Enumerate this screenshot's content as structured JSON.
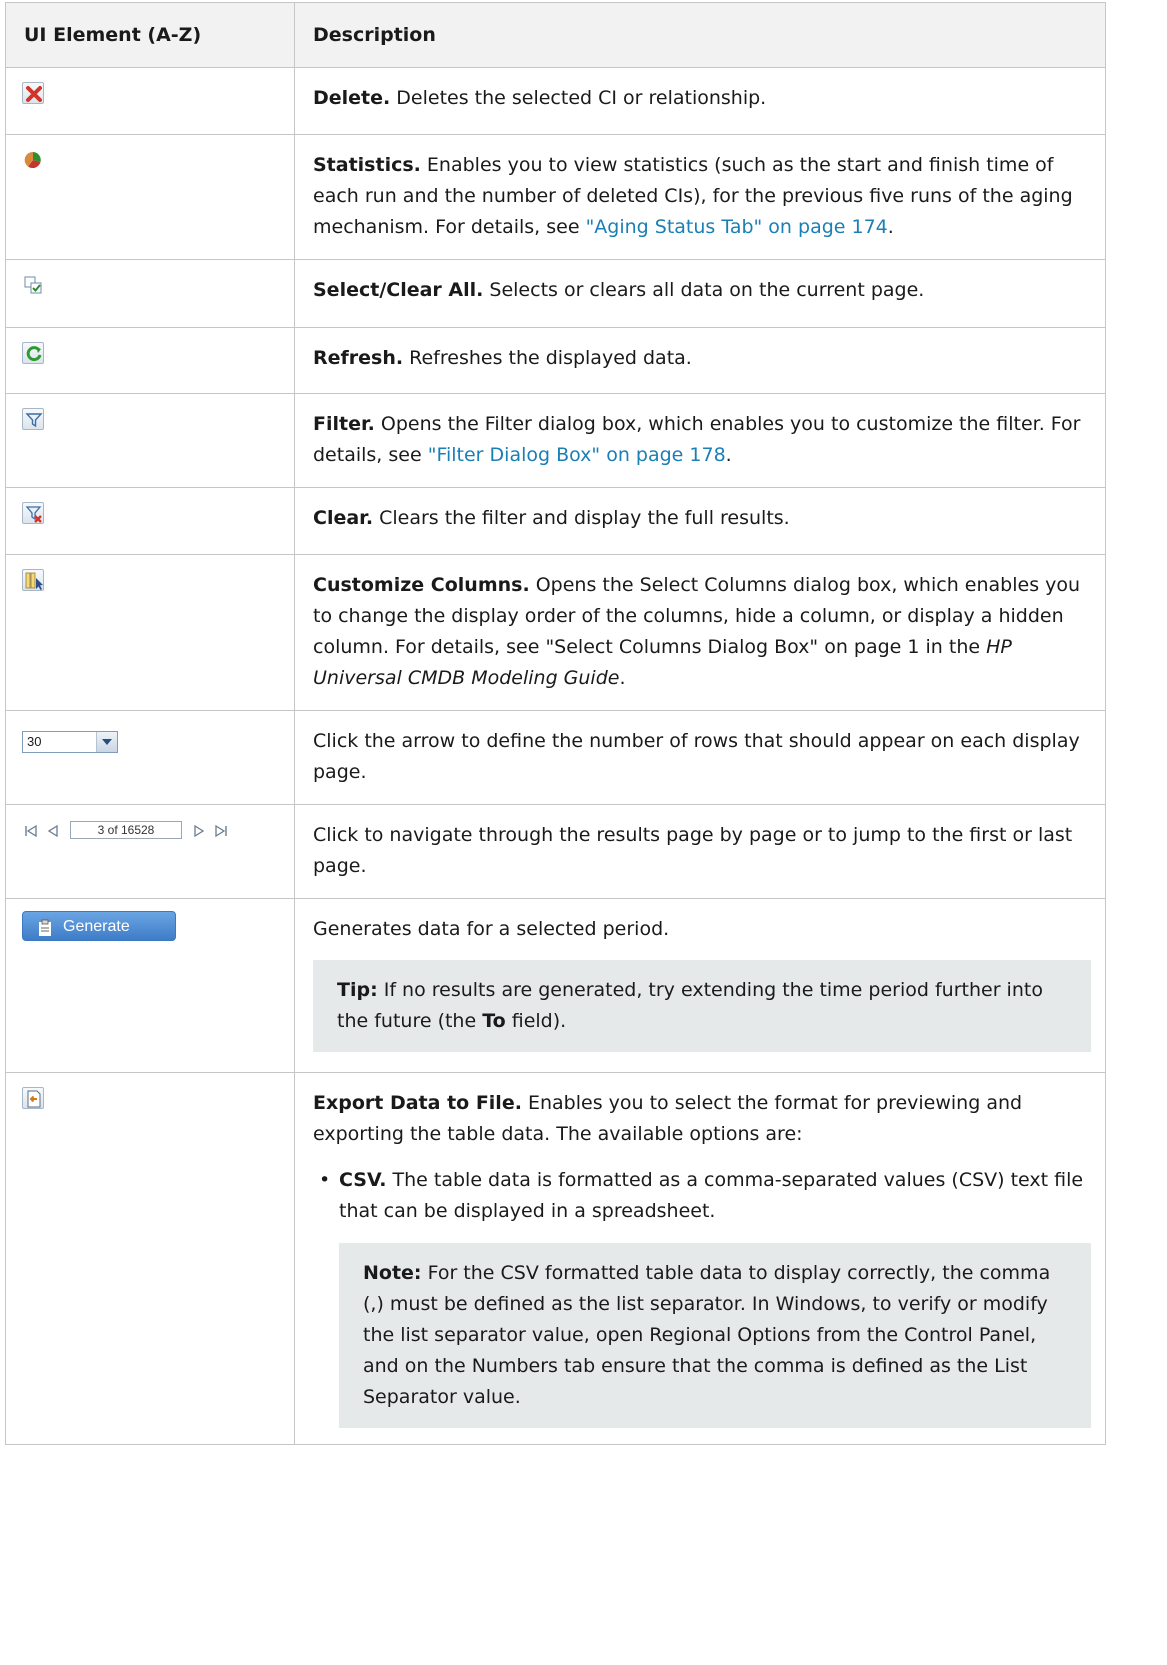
{
  "header": {
    "col1": "UI Element (A-Z)",
    "col2": "Description"
  },
  "rows": [
    {
      "name": "Delete.",
      "text": " Deletes the selected CI or relationship.",
      "icon": "delete-icon"
    },
    {
      "name": "Statistics.",
      "text": " Enables you to view statistics (such as the start and finish time of each run and the number of deleted CIs), for the previous five runs of the aging mechanism. For details, see ",
      "link": "\"Aging Status Tab\" on page 174",
      "after": ".",
      "icon": "statistics-icon"
    },
    {
      "name": "Select/Clear All.",
      "text": " Selects or clears all data on the current page.",
      "icon": "select-clear-all-icon"
    },
    {
      "name": "Refresh.",
      "text": " Refreshes the displayed data.",
      "icon": "refresh-icon"
    },
    {
      "name": "Filter.",
      "text": " Opens the Filter dialog box, which enables you to customize the filter. For details, see ",
      "link": "\"Filter Dialog Box\" on page 178",
      "after": ".",
      "icon": "filter-icon"
    },
    {
      "name": "Clear.",
      "text": " Clears the filter and display the full results.",
      "icon": "clear-filter-icon"
    },
    {
      "name": "Customize Columns.",
      "text": " Opens the Select Columns dialog box, which enables you to change the display order of the columns, hide a column, or display a hidden column. For details, see \"Select Columns Dialog Box\" on page 1 in the ",
      "italic": "HP Universal CMDB Modeling Guide",
      "after": ".",
      "icon": "customize-columns-icon"
    },
    {
      "text": "Click the arrow to define the number of rows that should appear on each display page.",
      "dropdown_value": "30"
    },
    {
      "text": "Click to navigate through the results page by page or to jump to the first or last page.",
      "pager_value": "3 of 16528"
    },
    {
      "text": "Generates data for a selected period.",
      "button_label": "Generate",
      "tip_label": "Tip:",
      "tip_text": " If no results are generated, try extending the time period further into the future (the ",
      "tip_bold": "To",
      "tip_after": " field)."
    },
    {
      "name": "Export Data to File.",
      "text": " Enables you to select the format for previewing and exporting the table data. The available options are:",
      "icon": "export-data-icon",
      "option_name": "CSV.",
      "option_text": " The table data is formatted as a comma-separated values (CSV) text file that can be displayed in a spreadsheet.",
      "note_label": "Note:",
      "note_text": " For the CSV formatted table data to display correctly, the comma (,) must be defined as the list separator. In Windows, to verify or modify the list separator value, open Regional Options from the Control Panel, and on the Numbers tab ensure that the comma is defined as the List Separator value."
    }
  ]
}
